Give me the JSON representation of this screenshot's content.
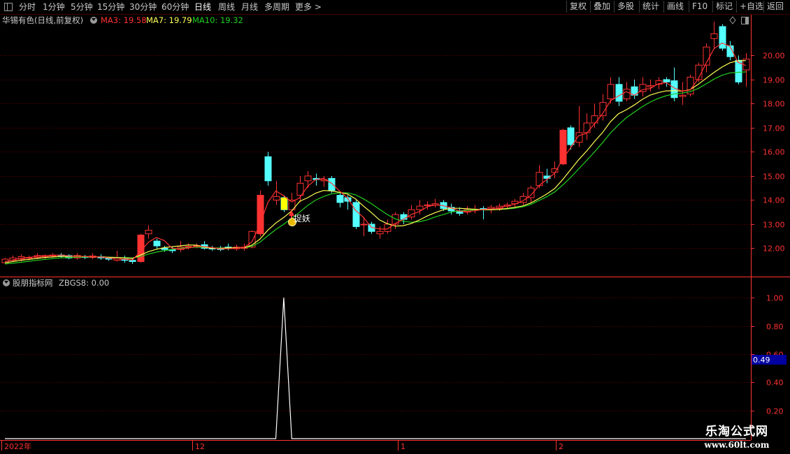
{
  "toolbar": {
    "periods": [
      "分时",
      "1分钟",
      "5分钟",
      "15分钟",
      "30分钟",
      "60分钟",
      "日线",
      "周线",
      "月线",
      "多周期",
      "更多 >"
    ],
    "active_period": "日线",
    "right_buttons": [
      "复权",
      "叠加",
      "多股",
      "统计",
      "画线",
      "F10",
      "标记",
      "+自选",
      "返回"
    ]
  },
  "main_info": {
    "stock_title": "华锡有色(日线,前复权)",
    "ma3": "MA3: 19.58",
    "ma7": "MA7: 19.79",
    "ma10": "MA10: 19.32"
  },
  "sub_info": {
    "label": "股朋指标网",
    "value": "ZBGS8: 0.00",
    "cursor_value": "0.49"
  },
  "signal_label": "捉妖",
  "x_axis": {
    "year": "2022年",
    "ticks": [
      "12",
      "1",
      "2"
    ]
  },
  "watermark": {
    "name": "乐淘公式网",
    "url": "www.60lt.com"
  },
  "colors": {
    "up": "#ff3232",
    "down": "#54ffff",
    "ma3": "#ff3232",
    "ma7": "#ffff54",
    "ma10": "#20d020",
    "axis": "#ff3232",
    "grid": "#7a0000"
  },
  "chart_data": [
    {
      "type": "candlestick",
      "title": "华锡有色(日线,前复权)",
      "y_ticks": [
        "12.00",
        "13.00",
        "14.00",
        "15.00",
        "16.00",
        "17.00",
        "18.00",
        "19.00",
        "20.00"
      ],
      "ylim": [
        11.0,
        21.2
      ],
      "series_names": [
        "MA3",
        "MA7",
        "MA10"
      ],
      "candles": [
        [
          11.4,
          11.55,
          11.35,
          11.6
        ],
        [
          11.5,
          11.6,
          11.45,
          11.7
        ],
        [
          11.55,
          11.65,
          11.45,
          11.75
        ],
        [
          11.6,
          11.62,
          11.5,
          11.7
        ],
        [
          11.62,
          11.7,
          11.55,
          11.8
        ],
        [
          11.65,
          11.7,
          11.55,
          11.75
        ],
        [
          11.68,
          11.72,
          11.6,
          11.8
        ],
        [
          11.72,
          11.7,
          11.62,
          11.8
        ],
        [
          11.7,
          11.6,
          11.55,
          11.75
        ],
        [
          11.6,
          11.7,
          11.52,
          11.8
        ],
        [
          11.65,
          11.62,
          11.55,
          11.72
        ],
        [
          11.62,
          11.68,
          11.55,
          11.8
        ],
        [
          11.65,
          11.6,
          11.52,
          11.75
        ],
        [
          11.6,
          11.55,
          11.48,
          11.65
        ],
        [
          11.5,
          11.62,
          11.45,
          11.9
        ],
        [
          11.55,
          11.5,
          11.4,
          11.7
        ],
        [
          11.5,
          11.45,
          11.35,
          11.6
        ],
        [
          11.45,
          12.55,
          11.4,
          12.6
        ],
        [
          12.6,
          12.75,
          12.4,
          12.95
        ],
        [
          12.3,
          12.1,
          11.95,
          12.4
        ],
        [
          12.0,
          11.95,
          11.85,
          12.1
        ],
        [
          11.95,
          11.9,
          11.8,
          12.05
        ],
        [
          11.95,
          12.05,
          11.85,
          12.3
        ],
        [
          12.05,
          12.08,
          11.95,
          12.2
        ],
        [
          12.1,
          12.12,
          12.0,
          12.2
        ],
        [
          12.15,
          12.0,
          11.95,
          12.3
        ],
        [
          12.0,
          11.98,
          11.9,
          12.1
        ],
        [
          12.0,
          11.95,
          11.88,
          12.1
        ],
        [
          12.05,
          12.0,
          11.92,
          12.2
        ],
        [
          11.98,
          12.05,
          11.9,
          12.15
        ],
        [
          12.0,
          12.05,
          11.9,
          12.2
        ],
        [
          12.05,
          12.7,
          12.0,
          12.75
        ],
        [
          12.6,
          14.2,
          12.5,
          14.4
        ],
        [
          15.8,
          14.8,
          14.6,
          16.0
        ],
        [
          14.0,
          14.15,
          13.8,
          14.8
        ],
        [
          14.1,
          13.6,
          13.5,
          14.2
        ],
        [
          13.6,
          14.0,
          13.4,
          14.3
        ],
        [
          14.2,
          14.7,
          13.9,
          15.0
        ],
        [
          14.8,
          15.0,
          14.5,
          15.2
        ],
        [
          14.9,
          14.85,
          14.6,
          15.1
        ],
        [
          14.8,
          14.85,
          14.55,
          15.0
        ],
        [
          14.9,
          14.4,
          14.3,
          15.0
        ],
        [
          14.2,
          13.9,
          13.7,
          14.3
        ],
        [
          14.1,
          13.95,
          13.6,
          14.2
        ],
        [
          13.9,
          12.9,
          12.8,
          14.0
        ],
        [
          13.0,
          13.0,
          12.5,
          13.3
        ],
        [
          13.0,
          12.7,
          12.6,
          13.1
        ],
        [
          12.6,
          12.7,
          12.4,
          12.9
        ],
        [
          12.7,
          13.0,
          12.6,
          13.2
        ],
        [
          13.0,
          13.4,
          12.8,
          13.5
        ],
        [
          13.4,
          13.2,
          13.0,
          13.5
        ],
        [
          13.3,
          13.6,
          13.2,
          13.8
        ],
        [
          13.6,
          13.75,
          13.4,
          14.0
        ],
        [
          13.8,
          13.8,
          13.6,
          13.95
        ],
        [
          13.8,
          13.85,
          13.7,
          14.05
        ],
        [
          13.9,
          13.65,
          13.55,
          14.0
        ],
        [
          13.7,
          13.55,
          13.4,
          13.85
        ],
        [
          13.55,
          13.45,
          13.35,
          13.7
        ],
        [
          13.5,
          13.6,
          13.4,
          13.75
        ],
        [
          13.6,
          13.62,
          13.45,
          13.8
        ],
        [
          13.65,
          13.6,
          13.2,
          13.75
        ],
        [
          13.6,
          13.7,
          13.45,
          13.8
        ],
        [
          13.65,
          13.75,
          13.55,
          13.85
        ],
        [
          13.75,
          13.8,
          13.65,
          13.9
        ],
        [
          13.85,
          13.95,
          13.7,
          14.05
        ],
        [
          13.9,
          14.15,
          13.8,
          14.3
        ],
        [
          14.1,
          14.5,
          13.9,
          14.6
        ],
        [
          14.6,
          15.15,
          14.5,
          15.45
        ],
        [
          15.0,
          14.9,
          14.7,
          15.3
        ],
        [
          15.15,
          15.3,
          14.9,
          15.6
        ],
        [
          15.5,
          16.9,
          15.45,
          16.95
        ],
        [
          17.0,
          16.3,
          16.1,
          17.1
        ],
        [
          16.4,
          16.8,
          16.2,
          17.9
        ],
        [
          16.8,
          17.2,
          16.5,
          17.6
        ],
        [
          17.2,
          17.5,
          17.0,
          18.0
        ],
        [
          17.5,
          18.05,
          17.3,
          18.4
        ],
        [
          18.2,
          18.8,
          18.0,
          19.1
        ],
        [
          18.8,
          18.1,
          17.9,
          19.1
        ],
        [
          18.2,
          18.6,
          18.1,
          18.9
        ],
        [
          18.7,
          18.35,
          18.2,
          19.0
        ],
        [
          18.5,
          18.8,
          18.3,
          19.1
        ],
        [
          18.7,
          18.75,
          18.5,
          19.0
        ],
        [
          18.8,
          18.95,
          18.6,
          19.1
        ],
        [
          19.0,
          18.9,
          18.7,
          19.1
        ],
        [
          18.95,
          18.25,
          18.1,
          19.5
        ],
        [
          18.3,
          18.35,
          17.95,
          18.9
        ],
        [
          18.4,
          19.1,
          18.3,
          19.2
        ],
        [
          19.0,
          19.6,
          18.9,
          19.7
        ],
        [
          19.6,
          20.35,
          19.3,
          20.5
        ],
        [
          20.7,
          20.9,
          20.3,
          21.4
        ],
        [
          21.2,
          20.3,
          20.2,
          21.3
        ],
        [
          20.4,
          19.95,
          19.8,
          20.6
        ],
        [
          19.8,
          18.9,
          18.8,
          20.0
        ],
        [
          19.4,
          19.85,
          18.7,
          20.1
        ]
      ],
      "ma3": [
        11.45,
        11.52,
        11.58,
        11.62,
        11.66,
        11.69,
        11.71,
        11.72,
        11.68,
        11.66,
        11.66,
        11.65,
        11.64,
        11.6,
        11.56,
        11.55,
        11.52,
        11.86,
        12.25,
        12.45,
        12.32,
        12.0,
        11.97,
        12.01,
        12.08,
        12.07,
        12.03,
        11.98,
        11.98,
        12.0,
        12.03,
        12.27,
        12.98,
        13.9,
        14.38,
        14.18,
        13.92,
        14.1,
        14.57,
        14.85,
        14.9,
        14.7,
        14.38,
        14.08,
        13.58,
        13.28,
        12.87,
        12.8,
        12.8,
        13.03,
        13.2,
        13.4,
        13.52,
        13.72,
        13.8,
        13.77,
        13.68,
        13.55,
        13.53,
        13.56,
        13.61,
        13.64,
        13.68,
        13.75,
        13.83,
        13.97,
        14.2,
        14.6,
        14.85,
        15.12,
        15.7,
        16.17,
        16.67,
        16.77,
        17.17,
        17.58,
        18.12,
        18.32,
        18.5,
        18.35,
        18.58,
        18.63,
        18.83,
        18.87,
        18.65,
        18.52,
        18.57,
        19.02,
        19.68,
        20.28,
        20.52,
        20.38,
        19.72,
        19.58
      ],
      "ma7": [
        11.4,
        11.45,
        11.5,
        11.54,
        11.58,
        11.62,
        11.64,
        11.66,
        11.67,
        11.67,
        11.66,
        11.65,
        11.64,
        11.63,
        11.62,
        11.6,
        11.58,
        11.72,
        11.86,
        11.96,
        12.03,
        12.07,
        12.1,
        12.14,
        12.13,
        12.05,
        12.0,
        12.0,
        12.02,
        12.02,
        12.02,
        12.13,
        12.38,
        12.75,
        13.05,
        13.28,
        13.55,
        13.95,
        14.1,
        14.29,
        14.4,
        14.38,
        14.32,
        14.25,
        14.05,
        13.75,
        13.48,
        13.18,
        13.02,
        12.92,
        12.94,
        13.03,
        13.17,
        13.34,
        13.48,
        13.6,
        13.66,
        13.66,
        13.64,
        13.62,
        13.6,
        13.6,
        13.61,
        13.65,
        13.7,
        13.76,
        13.88,
        14.06,
        14.25,
        14.48,
        14.85,
        15.26,
        15.67,
        16.03,
        16.43,
        16.8,
        17.25,
        17.58,
        17.75,
        17.95,
        18.18,
        18.36,
        18.46,
        18.53,
        18.54,
        18.52,
        18.58,
        18.8,
        19.05,
        19.3,
        19.52,
        19.7,
        19.78,
        19.79
      ],
      "ma10": [
        11.35,
        11.38,
        11.42,
        11.46,
        11.5,
        11.54,
        11.57,
        11.6,
        11.62,
        11.63,
        11.64,
        11.64,
        11.64,
        11.63,
        11.62,
        11.61,
        11.6,
        11.66,
        11.76,
        11.84,
        11.9,
        11.95,
        12.0,
        12.03,
        12.05,
        12.04,
        12.02,
        12.01,
        12.01,
        12.01,
        12.02,
        12.08,
        12.25,
        12.52,
        12.78,
        13.0,
        13.24,
        13.5,
        13.78,
        14.0,
        14.15,
        14.26,
        14.3,
        14.3,
        14.22,
        14.05,
        13.85,
        13.62,
        13.4,
        13.22,
        13.12,
        13.08,
        13.1,
        13.18,
        13.3,
        13.4,
        13.5,
        13.55,
        13.58,
        13.59,
        13.6,
        13.6,
        13.61,
        13.63,
        13.66,
        13.72,
        13.82,
        13.98,
        14.14,
        14.34,
        14.62,
        14.94,
        15.29,
        15.64,
        16.0,
        16.38,
        16.78,
        17.12,
        17.42,
        17.65,
        17.88,
        18.07,
        18.22,
        18.33,
        18.4,
        18.44,
        18.5,
        18.63,
        18.82,
        19.02,
        19.18,
        19.28,
        19.3,
        19.32
      ]
    },
    {
      "type": "line",
      "title": "ZBGS8",
      "y_ticks": [
        "0.20",
        "0.40",
        "0.60",
        "0.80",
        "1.00"
      ],
      "ylim": [
        0.0,
        1.1
      ],
      "values": [
        0,
        0,
        0,
        0,
        0,
        0,
        0,
        0,
        0,
        0,
        0,
        0,
        0,
        0,
        0,
        0,
        0,
        0,
        0,
        0,
        0,
        0,
        0,
        0,
        0,
        0,
        0,
        0,
        0,
        0,
        0,
        0,
        0,
        0,
        0,
        1,
        0,
        0,
        0,
        0,
        0,
        0,
        0,
        0,
        0,
        0,
        0,
        0,
        0,
        0,
        0,
        0,
        0,
        0,
        0,
        0,
        0,
        0,
        0,
        0,
        0,
        0,
        0,
        0,
        0,
        0,
        0,
        0,
        0,
        0,
        0,
        0,
        0,
        0,
        0,
        0,
        0,
        0,
        0,
        0,
        0,
        0,
        0,
        0,
        0,
        0,
        0,
        0,
        0,
        0,
        0,
        0,
        0,
        0
      ]
    }
  ]
}
